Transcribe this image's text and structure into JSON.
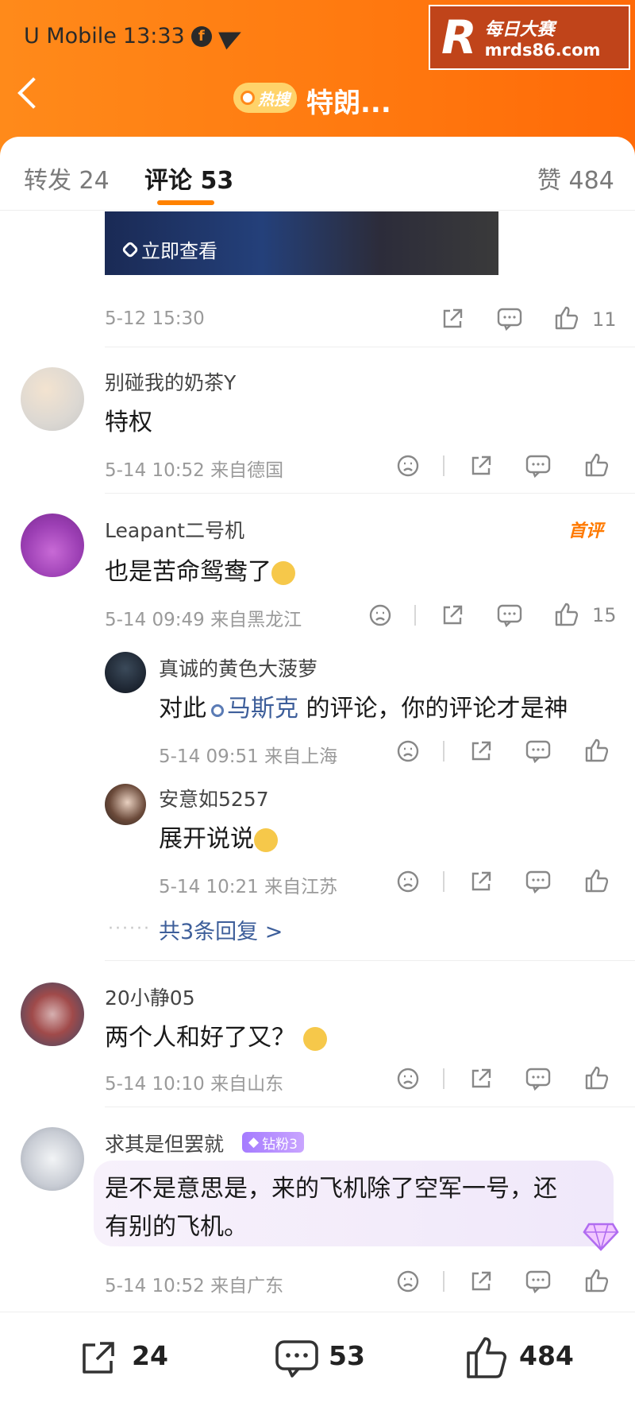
{
  "status_bar": {
    "carrier": "U Mobile",
    "time": "13:33"
  },
  "watermark": {
    "logo_letter": "R",
    "name": "每日大赛",
    "domain": "mrds86.com"
  },
  "header": {
    "hot_badge": "热搜",
    "title": "特朗..."
  },
  "tabs": [
    {
      "label": "转发",
      "count": "24"
    },
    {
      "label": "评论",
      "count": "53"
    },
    {
      "label": "赞",
      "count": "484"
    }
  ],
  "media_card": {
    "link_label": "立即查看"
  },
  "post_meta": {
    "time": "5-12 15:30",
    "likes": "11"
  },
  "comments": [
    {
      "user": "别碰我的奶茶Y",
      "text": "特权",
      "meta": "5-14 10:52 来自德国"
    },
    {
      "user": "Leapant二号机",
      "badge": "首评",
      "text": "也是苦命鸳鸯了",
      "meta": "5-14 09:49 来自黑龙江",
      "likes": "15",
      "replies": [
        {
          "user": "真诚的黄色大菠萝",
          "prefix": "对此",
          "mention": "马斯克",
          "suffix": " 的评论，你的评论才是神",
          "meta": "5-14 09:51 来自上海"
        },
        {
          "user": "安意如5257",
          "text": "展开说说",
          "meta": "5-14 10:21 来自江苏"
        }
      ],
      "more_replies": "共3条回复 >"
    },
    {
      "user": "20小静05",
      "text": "两个人和好了又？",
      "meta": "5-14 10:10 来自山东"
    },
    {
      "user": "求其是但罢就",
      "fan_badge": "钻粉3",
      "text_line1": "是不是意思是，来的飞机除了空军一号，还",
      "text_line2": "有别的飞机。",
      "meta": "5-14 10:52 来自广东"
    }
  ],
  "bottom_bar": {
    "reposts": "24",
    "comments": "53",
    "likes": "484"
  },
  "colors": {
    "header_orange": "#ff7a10",
    "accent": "#ff8200",
    "link_blue": "#3d5e9a",
    "fan_purple": "#a57bff"
  }
}
